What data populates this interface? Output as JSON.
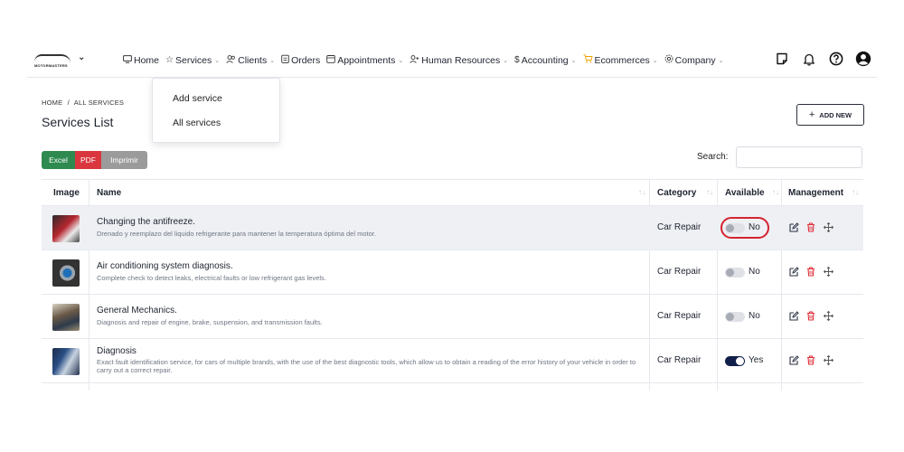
{
  "brand": {
    "logo_text": "MOTORMASTERS"
  },
  "nav": {
    "items": [
      {
        "label": "Home",
        "icon": "monitor-icon",
        "caret": false
      },
      {
        "label": "Services",
        "icon": "star-icon",
        "caret": true
      },
      {
        "label": "Clients",
        "icon": "users-icon",
        "caret": true
      },
      {
        "label": "Orders",
        "icon": "clipboard-icon",
        "caret": false
      },
      {
        "label": "Appointments",
        "icon": "calendar-icon",
        "caret": true
      },
      {
        "label": "Human Resources",
        "icon": "user-plus-icon",
        "caret": true
      },
      {
        "label": "Accounting",
        "icon": "dollar-icon",
        "caret": true
      },
      {
        "label": "Ecommerces",
        "icon": "cart-icon",
        "caret": true
      },
      {
        "label": "Company",
        "icon": "gear-icon",
        "caret": true
      }
    ]
  },
  "dropdown": {
    "items": [
      "Add service",
      "All services"
    ]
  },
  "breadcrumb": {
    "home": "HOME",
    "sep": "/",
    "current": "ALL SERVICES"
  },
  "page": {
    "title": "Services List",
    "add_new": "ADD NEW"
  },
  "exports": {
    "excel": "Excel",
    "pdf": "PDF",
    "print": "Imprimir"
  },
  "search": {
    "label": "Search:",
    "value": ""
  },
  "table": {
    "headers": {
      "image": "Image",
      "name": "Name",
      "category": "Category",
      "available": "Available",
      "management": "Management"
    },
    "rows": [
      {
        "name": "Changing the antifreeze.",
        "description": "Drenado y reemplazo del liquido refrigerante para mantener la temperatura óptima del motor.",
        "category": "Car Repair",
        "available": false,
        "available_label": "No",
        "highlighted": true,
        "circled": true,
        "thumb_color": "#b5262f"
      },
      {
        "name": "Air conditioning system diagnosis.",
        "description": "Complete check to detect leaks, electrical faults or low refrigerant gas levels.",
        "category": "Car Repair",
        "available": false,
        "available_label": "No",
        "highlighted": false,
        "circled": false,
        "thumb_color": "#4a5560"
      },
      {
        "name": "General Mechanics.",
        "description": "Diagnosis and repair of engine, brake, suspension, and transmission faults.",
        "category": "Car Repair",
        "available": false,
        "available_label": "No",
        "highlighted": false,
        "circled": false,
        "thumb_color": "#6b5a48"
      },
      {
        "name": "Diagnosis",
        "description": "Exact fault identification service, for cars of multiple brands, with the use of the best diagnostic tools, which allow us to obtain a reading of the error history of your vehicle in order to carry out a correct repair.",
        "category": "Car Repair",
        "available": true,
        "available_label": "Yes",
        "highlighted": false,
        "circled": false,
        "thumb_color": "#2a4f86"
      }
    ]
  },
  "colors": {
    "accent_navy": "#10204a",
    "excel": "#2f8a4f",
    "pdf": "#d9363e",
    "print": "#9b9b9b",
    "edit": "#2a3142",
    "delete": "#e0303a",
    "circle": "#d62330"
  }
}
